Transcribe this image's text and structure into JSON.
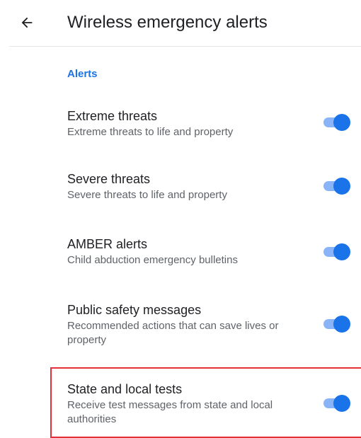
{
  "app_bar": {
    "back_icon": "arrow-back-icon",
    "title": "Wireless emergency alerts"
  },
  "section": {
    "header": "Alerts"
  },
  "items": [
    {
      "title": "Extreme threats",
      "summary": "Extreme threats to life and property",
      "enabled": true
    },
    {
      "title": "Severe threats",
      "summary": "Severe threats to life and property",
      "enabled": true
    },
    {
      "title": "AMBER alerts",
      "summary": "Child abduction emergency bulletins",
      "enabled": true
    },
    {
      "title": "Public safety messages",
      "summary": "Recommended actions that can save lives or property",
      "enabled": true
    },
    {
      "title": "State and local tests",
      "summary": "Receive test messages from state and local authorities",
      "enabled": true
    }
  ],
  "colors": {
    "accent": "#1a73e8",
    "switch_track": "#8ab4f8",
    "highlight": "#e5303b"
  }
}
